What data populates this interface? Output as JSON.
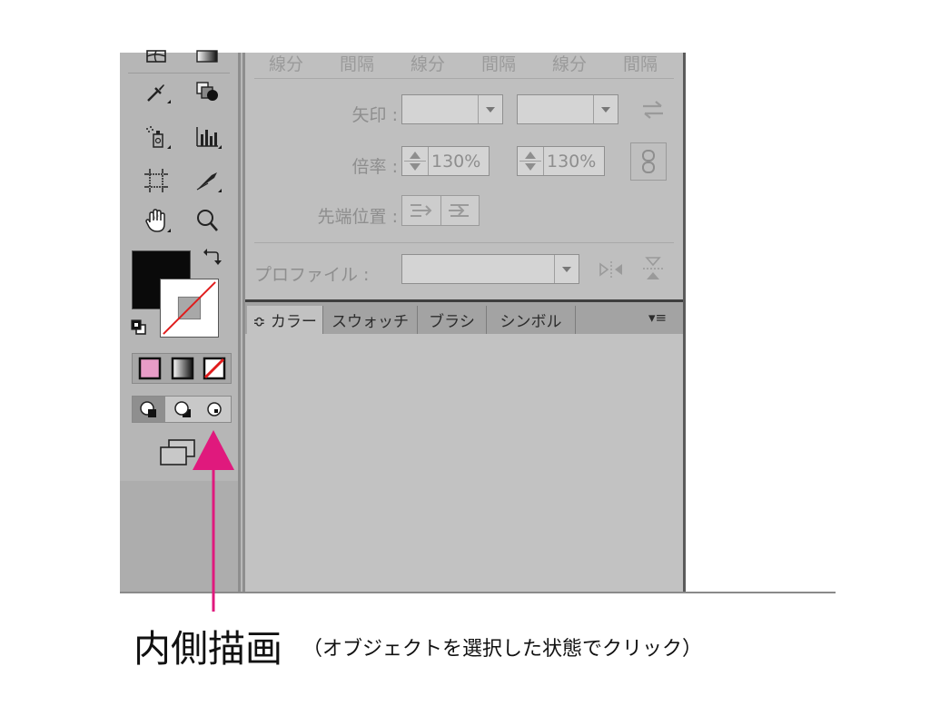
{
  "stroke_panel": {
    "headers": [
      "線分",
      "間隔",
      "線分",
      "間隔",
      "線分",
      "間隔"
    ],
    "arrow_label": "矢印 :",
    "scale_label": "倍率 :",
    "scale_start": "130%",
    "scale_end": "130%",
    "tip_position_label": "先端位置 :",
    "profile_label": "プロファイル :"
  },
  "color_panel": {
    "tabs": [
      "≎ カラー",
      "スウォッチ",
      "ブラシ",
      "シンボル"
    ],
    "menu_glyph": "▾≡"
  },
  "caption": {
    "title": "内側描画",
    "note": "（オブジェクトを選択した状態でクリック）"
  },
  "colors": {
    "annotation_arrow": "#e0197d",
    "fill_swatch": "#0a0a0a",
    "none_slash": "#e01b1b"
  },
  "icons": [
    "mesh-icon",
    "gradient-icon",
    "eyedropper-icon",
    "blend-icon",
    "symbol-sprayer-icon",
    "column-graph-icon",
    "artboard-icon",
    "slice-icon",
    "hand-icon",
    "zoom-icon",
    "swap-fill-stroke-icon",
    "default-colors-icon",
    "color-mode-icon",
    "gradient-mode-icon",
    "none-mode-icon",
    "draw-normal-icon",
    "draw-behind-icon",
    "draw-inside-icon",
    "screen-mode-icon"
  ]
}
